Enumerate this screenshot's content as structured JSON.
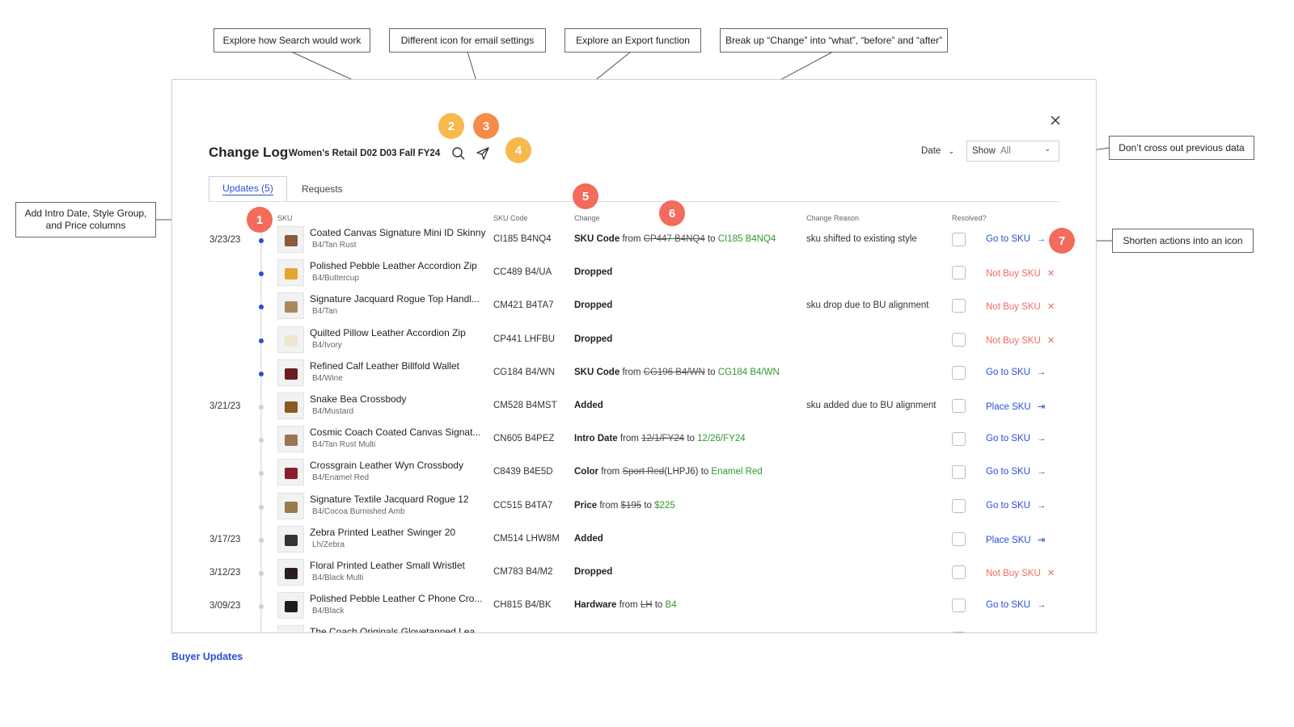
{
  "colors": {
    "blue": "#2a4fd6",
    "green": "#2f9a2f",
    "red": "#f06a62",
    "badge_orange": "#f58a4b",
    "badge_yellow": "#f7b94c",
    "badge_red": "#f26b5b"
  },
  "callouts": {
    "search": "Explore how Search would work",
    "email_icon": "Different icon for email settings",
    "export": "Explore an Export function",
    "break_change": "Break up “Change” into “what”, “before” and “after”",
    "no_crossout": "Don’t cross out previous data",
    "intro_cols": "Add Intro Date, Style Group, and Price columns",
    "shorten": "Shorten actions into an icon"
  },
  "badges": [
    "1",
    "2",
    "3",
    "4",
    "5",
    "6",
    "7"
  ],
  "modal": {
    "title": "Change Log",
    "subtitle": "Women's Retail D02 D03 Fall FY24",
    "close_icon": "close-icon",
    "date_filter": "Date",
    "show_label": "Show",
    "show_value": "All"
  },
  "tabs": {
    "updates": "Updates (5)",
    "requests": "Requests"
  },
  "columns": {
    "sku": "SKU",
    "sku_code": "SKU Code",
    "change": "Change",
    "reason": "Change Reason",
    "resolved": "Resolved?"
  },
  "rows": [
    {
      "date": "3/23/23",
      "unread": true,
      "name": "Coated Canvas Signature Mini ID Skinny",
      "variant": "B4/Tan Rust",
      "sku": "CI185 B4NQ4",
      "change_type": "SKU Code",
      "from_prefix": "from",
      "from": "CP447 B4NQ4",
      "to_prefix": "to",
      "to": "CI185 B4NQ4",
      "reason": "sku shifted to existing style",
      "action": "Go to SKU",
      "action_type": "go",
      "thumb": "#8a5a3c"
    },
    {
      "date": "",
      "unread": true,
      "name": "Polished Pebble Leather Accordion Zip",
      "variant": "B4/Buttercup",
      "sku": "CC489 B4/UA",
      "change_type": "Dropped",
      "reason": "",
      "action": "Not Buy SKU",
      "action_type": "not",
      "thumb": "#e3a72f"
    },
    {
      "date": "",
      "unread": true,
      "name": "Signature Jacquard Rogue Top Handl...",
      "variant": "B4/Tan",
      "sku": "CM421 B4TA7",
      "change_type": "Dropped",
      "reason": "sku drop due to BU alignment",
      "action": "Not Buy SKU",
      "action_type": "not",
      "thumb": "#a88a60"
    },
    {
      "date": "",
      "unread": true,
      "name": "Quilted Pillow Leather Accordion Zip",
      "variant": "B4/Ivory",
      "sku": "CP441 LHFBU",
      "change_type": "Dropped",
      "reason": "",
      "action": "Not Buy SKU",
      "action_type": "not",
      "thumb": "#efe6cf"
    },
    {
      "date": "",
      "unread": true,
      "name": "Refined Calf Leather Billfold Wallet",
      "variant": "B4/Wine",
      "sku": "CG184 B4/WN",
      "change_type": "SKU Code",
      "from_prefix": "from",
      "from": "CG196 B4/WN",
      "to_prefix": "to",
      "to": "CG184 B4/WN",
      "reason": "",
      "action": "Go to SKU",
      "action_type": "go",
      "thumb": "#6b1f22"
    },
    {
      "date": "3/21/23",
      "unread": false,
      "name": "Snake Bea Crossbody",
      "variant": "B4/Mustard",
      "sku": "CM528 B4MST",
      "change_type": "Added",
      "reason": "sku added due to BU alignment",
      "action": "Place SKU",
      "action_type": "place",
      "thumb": "#8a5a22"
    },
    {
      "date": "",
      "unread": false,
      "name": "Cosmic Coach Coated Canvas Signat...",
      "variant": "B4/Tan Rust Multi",
      "sku": "CN605 B4PEZ",
      "change_type": "Intro Date",
      "from_prefix": "from",
      "from": "12/1/FY24",
      "to_prefix": "to",
      "to": "12/26/FY24",
      "reason": "",
      "action": "Go to SKU",
      "action_type": "go",
      "thumb": "#9a7656"
    },
    {
      "date": "",
      "unread": false,
      "name": "Crossgrain Leather Wyn Crossbody",
      "variant": "B4/Enamel Red",
      "sku": "C8439 B4E5D",
      "change_type": "Color",
      "from_prefix": "from",
      "from": "Sport Red",
      "from_suffix": "(LHPJ6)",
      "to_prefix": "to",
      "to": "Enamel Red",
      "reason": "",
      "action": "Go to SKU",
      "action_type": "go",
      "thumb": "#8b1c2e"
    },
    {
      "date": "",
      "unread": false,
      "name": "Signature Textile Jacquard Rogue 12",
      "variant": "B4/Cocoa Burnished Amb",
      "sku": "CC515 B4TA7",
      "change_type": "Price",
      "from_prefix": "from",
      "from": "$195",
      "to_prefix": "to",
      "to": "$225",
      "reason": "",
      "action": "Go to SKU",
      "action_type": "go",
      "thumb": "#9b7a50"
    },
    {
      "date": "3/17/23",
      "unread": false,
      "name": "Zebra Printed Leather Swinger 20",
      "variant": "Lh/Zebra",
      "sku": "CM514 LHW8M",
      "change_type": "Added",
      "reason": "",
      "action": "Place SKU",
      "action_type": "place",
      "thumb": "#333333"
    },
    {
      "date": "3/12/23",
      "unread": false,
      "name": "Floral Printed Leather Small Wristlet",
      "variant": "B4/Black Multi",
      "sku": "CM783 B4/M2",
      "change_type": "Dropped",
      "reason": "",
      "action": "Not Buy SKU",
      "action_type": "not",
      "thumb": "#2b1e1e"
    },
    {
      "date": "3/09/23",
      "unread": false,
      "name": "Polished Pebble Leather C Phone Cro...",
      "variant": "B4/Black",
      "sku": "CH815 B4/BK",
      "change_type": "Hardware",
      "from_prefix": "from",
      "from": "LH",
      "to_prefix": "to",
      "to": "B4",
      "reason": "",
      "action": "Go to SKU",
      "action_type": "go",
      "thumb": "#1d1d1d"
    },
    {
      "date": "",
      "unread": false,
      "name": "The Coach Originals Glovetanned Lea...",
      "variant": "",
      "sku": "",
      "change_type": "",
      "reason": "",
      "action": "",
      "action_type": "",
      "thumb": "#f2f2f2"
    }
  ],
  "footer_link": "Buyer Updates"
}
